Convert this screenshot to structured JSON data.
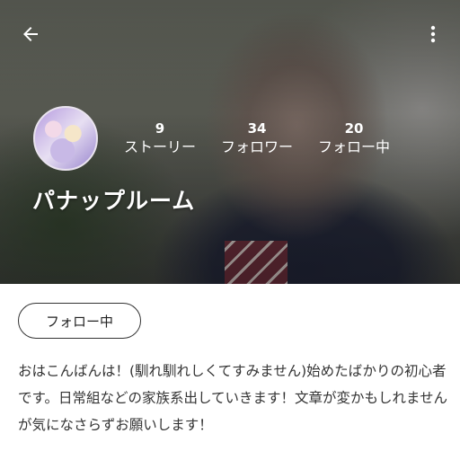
{
  "header": {
    "back_icon": "arrow-left-icon",
    "more_icon": "more-vertical-icon"
  },
  "profile": {
    "name": "パナップルーム",
    "stats": [
      {
        "count": "9",
        "label": "ストーリー"
      },
      {
        "count": "34",
        "label": "フォロワー"
      },
      {
        "count": "20",
        "label": "フォロー中"
      }
    ],
    "follow_button_label": "フォロー中",
    "bio": "おはこんばんは！(馴れ馴れしくてすみません)始めたばかりの初心者です。日常組などの家族系出していきます！文章が変かもしれませんが気になさらずお願いします！"
  }
}
